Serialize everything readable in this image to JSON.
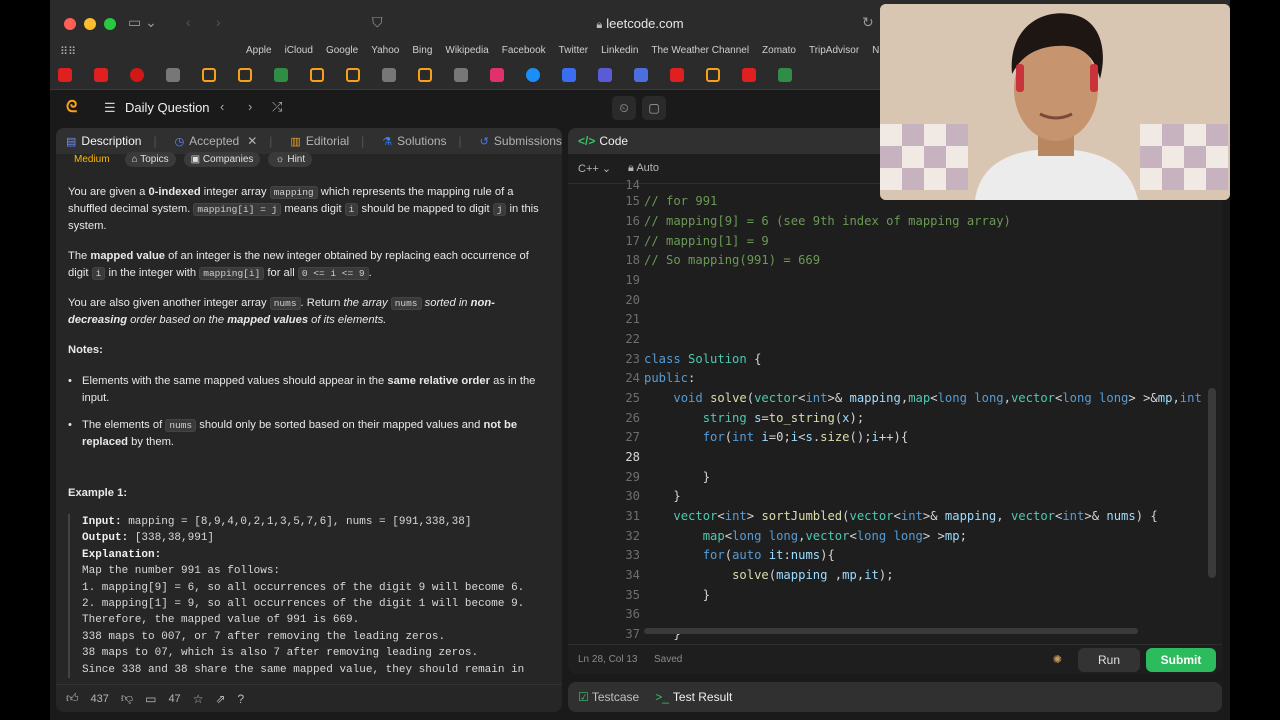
{
  "browser": {
    "url": "leetcode.com",
    "bookmarks": [
      "Apple",
      "iCloud",
      "Google",
      "Yahoo",
      "Bing",
      "Wikipedia",
      "Facebook",
      "Twitter",
      "Linkedin",
      "The Weather Channel",
      "Zomato",
      "TripAdvisor",
      "NDTV"
    ]
  },
  "header": {
    "title": "Daily Question"
  },
  "left": {
    "tabs": {
      "description": "Description",
      "accepted": "Accepted",
      "editorial": "Editorial",
      "solutions": "Solutions",
      "submissions": "Submissions"
    },
    "meta": {
      "difficulty": "Medium",
      "topics": "Topics",
      "companies": "Companies",
      "hint": "Hint"
    },
    "notes_title": "Notes:",
    "example_title": "Example 1:",
    "example_lines": {
      "input_label": "Input:",
      "input_value": " mapping = [8,9,4,0,2,1,3,5,7,6], nums = [991,338,38]",
      "output_label": "Output:",
      "output_value": " [338,38,991]",
      "explanation_label": "Explanation:",
      "l1": "Map the number 991 as follows:",
      "l2": "1. mapping[9] = 6, so all occurrences of the digit 9 will become 6.",
      "l3": "2. mapping[1] = 9, so all occurrences of the digit 1 will become 9.",
      "l4": "Therefore, the mapped value of 991 is 669.",
      "l5": "338 maps to 007, or 7 after removing the leading zeros.",
      "l6": "38 maps to 07, which is also 7 after removing leading zeros.",
      "l7": "Since 338 and 38 share the same mapped value, they should remain in"
    },
    "footer": {
      "likes": "437",
      "comments": "47"
    }
  },
  "right": {
    "tab_label": "Code",
    "language": "C++",
    "autocomplete": "Auto",
    "status_position": "Ln 28, Col 13",
    "status_saved": "Saved",
    "run": "Run",
    "submit": "Submit"
  },
  "code_lines": {
    "n14": "14",
    "n15": "15",
    "n16": "16",
    "n17": "17",
    "n18": "18",
    "n19": "19",
    "n20": "20",
    "n21": "21",
    "n22": "22",
    "n23": "23",
    "n24": "24",
    "n25": "25",
    "n26": "26",
    "n27": "27",
    "n28": "28",
    "n29": "29",
    "n30": "30",
    "n31": "31",
    "n32": "32",
    "n33": "33",
    "n34": "34",
    "n35": "35",
    "n36": "36",
    "n37": "37",
    "c15": "// for 991",
    "c16": "// mapping[9] = 6 (see 9th index of mapping array)",
    "c17": "// mapping[1] = 9",
    "c18": "// So mapping(991) = 669"
  },
  "bottom": {
    "testcase": "Testcase",
    "test_result": "Test Result"
  },
  "colors": {
    "accent_green": "#2cbb5d",
    "difficulty_medium": "#ffb800",
    "comment": "#6a9955",
    "keyword": "#569cd6"
  }
}
